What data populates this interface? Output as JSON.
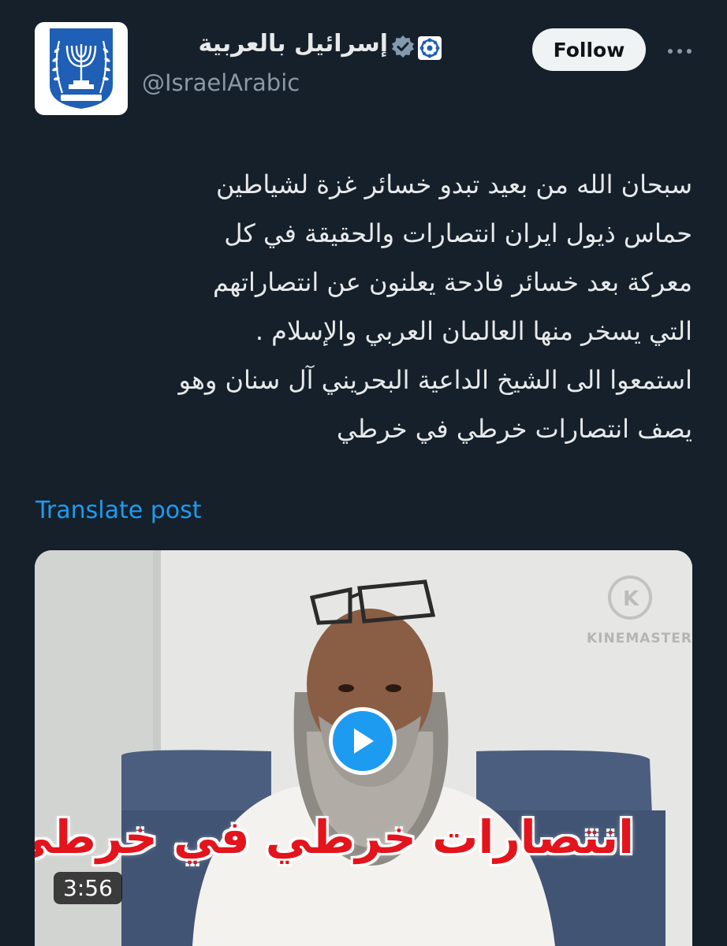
{
  "account": {
    "display_name": "إسرائيل بالعربية",
    "handle": "@IsraelArabic",
    "avatar_icon": "state-emblem-menorah-icon",
    "verified_icon": "verified-badge-icon",
    "affiliate_icon": "government-affiliate-icon"
  },
  "actions": {
    "follow_label": "Follow",
    "more_icon": "more-options-icon"
  },
  "post": {
    "text": "سبحان الله من بعيد تبدو خسائر غزة لشياطين\nحماس ذيول ايران انتصارات والحقيقة في كل\nمعركة بعد خسائر فادحة يعلنون عن انتصاراتهم\nالتي يسخر منها العالمان العربي والإسلام .\nاستمعوا الى الشيخ الداعية البحريني آل سنان وهو\nيصف انتصارات خرطي في خرطي",
    "translate_label": "Translate post"
  },
  "media": {
    "duration": "3:56",
    "caption": "انتصارات  خرطي في خرطي",
    "watermark": "KINEMASTER",
    "play_icon": "play-icon"
  },
  "colors": {
    "background": "#15202b",
    "text": "#e7e9ea",
    "secondary_text": "#8b98a5",
    "link": "#1d9bf0",
    "caption_red": "#e3141c"
  }
}
